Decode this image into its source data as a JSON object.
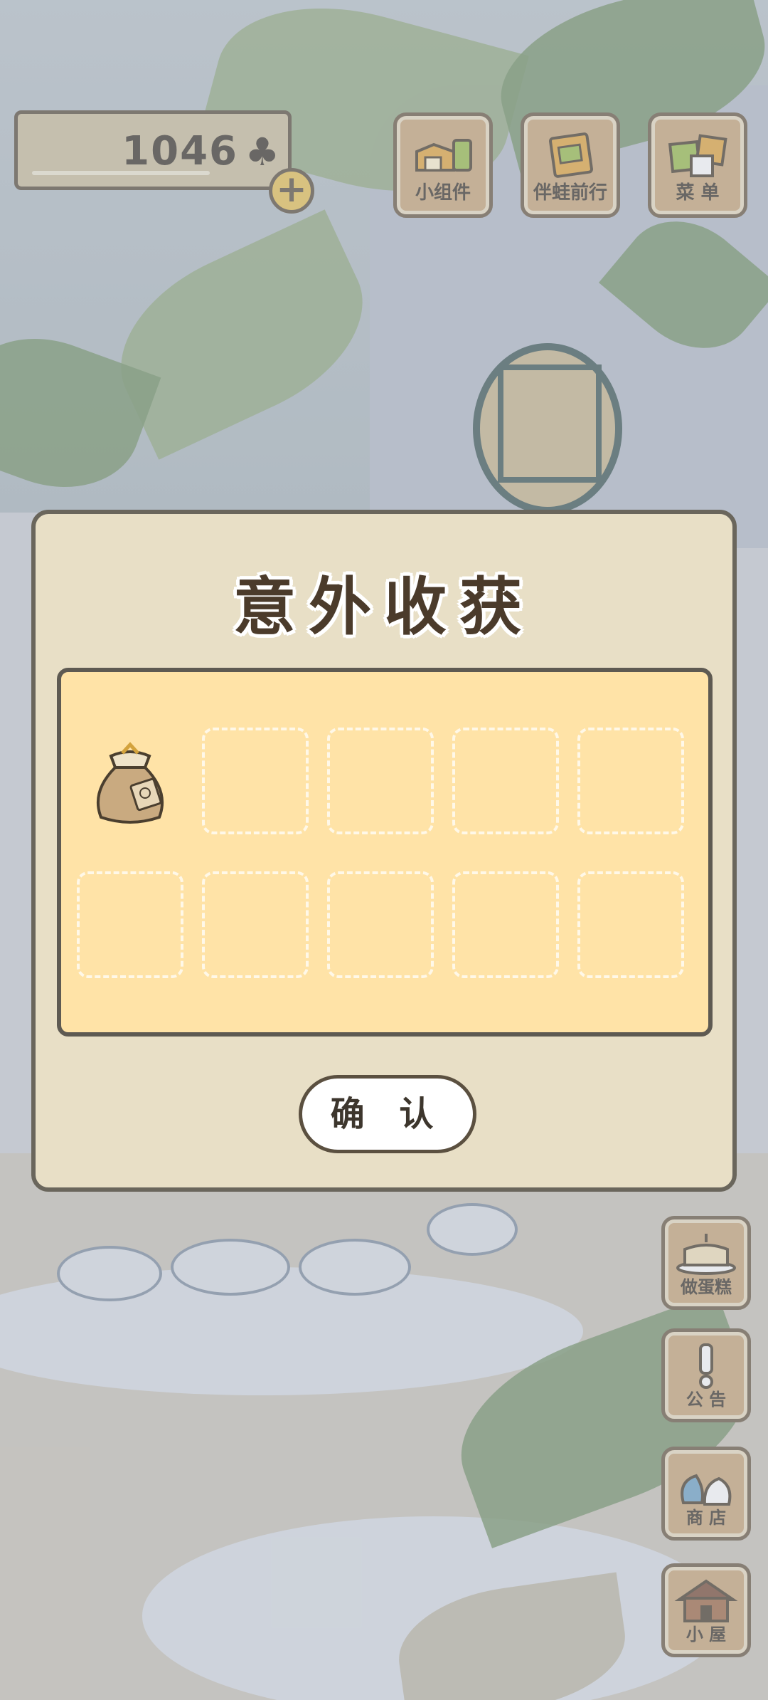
{
  "hud": {
    "clover_count": "1046",
    "clover_icon": "clover-icon",
    "add_label": "+"
  },
  "top_menu": [
    {
      "label": "小组件",
      "icon": "widget-icon"
    },
    {
      "label": "伴蛙前行",
      "icon": "album-icon"
    },
    {
      "label": "菜 单",
      "icon": "menu-icon"
    }
  ],
  "side_menu": [
    {
      "label": "做蛋糕",
      "icon": "cake-icon"
    },
    {
      "label": "公 告",
      "icon": "notice-icon"
    },
    {
      "label": "商 店",
      "icon": "shop-icon"
    },
    {
      "label": "小 屋",
      "icon": "house-icon"
    }
  ],
  "dialog": {
    "title": "意外收获",
    "items": [
      {
        "slot": 1,
        "icon": "seed-bag-icon",
        "filled": true
      }
    ],
    "slot_count": 10,
    "confirm_label": "确 认"
  },
  "colors": {
    "panel_bg": "#e8dfc6",
    "reward_bg": "#ffe3a7",
    "wood": "#c8a77a",
    "outline": "#5b5040"
  }
}
